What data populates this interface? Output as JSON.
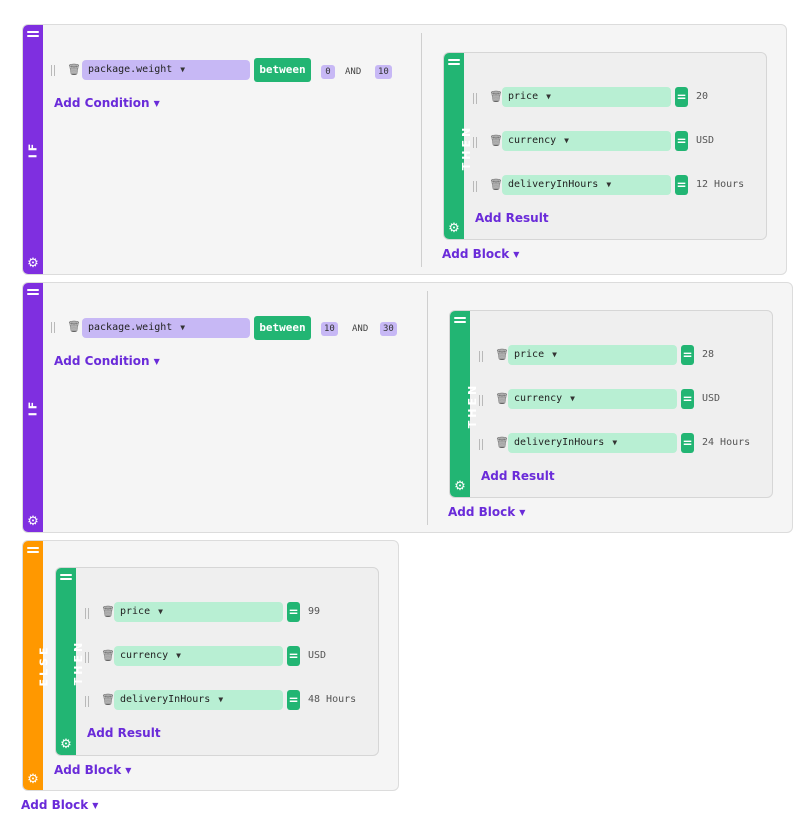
{
  "labels": {
    "if": "IF",
    "then": "THEN",
    "else": "ELSE",
    "add_condition": "Add Condition",
    "add_block": "Add Block",
    "add_result": "Add Result",
    "and": "AND",
    "equals": "="
  },
  "icons": {
    "drag_handle": "drag-handle-icon",
    "trash": "trash-icon",
    "gear": "gear-icon",
    "caret": "caret-down-icon"
  },
  "colors": {
    "if_bar": "#7f2fe0",
    "else_bar": "#ff9800",
    "then_bar": "#22b573",
    "field_pill": "#b8efd3",
    "condition_pill": "#c7b8f5",
    "link": "#6a2bd9"
  },
  "blocks": [
    {
      "condition": {
        "field": "package.weight",
        "operator": "between",
        "min": "0",
        "max": "10"
      },
      "results": [
        {
          "field": "price",
          "value": "20"
        },
        {
          "field": "currency",
          "value": "USD"
        },
        {
          "field": "deliveryInHours",
          "value": "12 Hours"
        }
      ]
    },
    {
      "condition": {
        "field": "package.weight",
        "operator": "between",
        "min": "10",
        "max": "30"
      },
      "results": [
        {
          "field": "price",
          "value": "28"
        },
        {
          "field": "currency",
          "value": "USD"
        },
        {
          "field": "deliveryInHours",
          "value": "24 Hours"
        }
      ]
    }
  ],
  "else_block": {
    "results": [
      {
        "field": "price",
        "value": "99"
      },
      {
        "field": "currency",
        "value": "USD"
      },
      {
        "field": "deliveryInHours",
        "value": "48 Hours"
      }
    ]
  }
}
